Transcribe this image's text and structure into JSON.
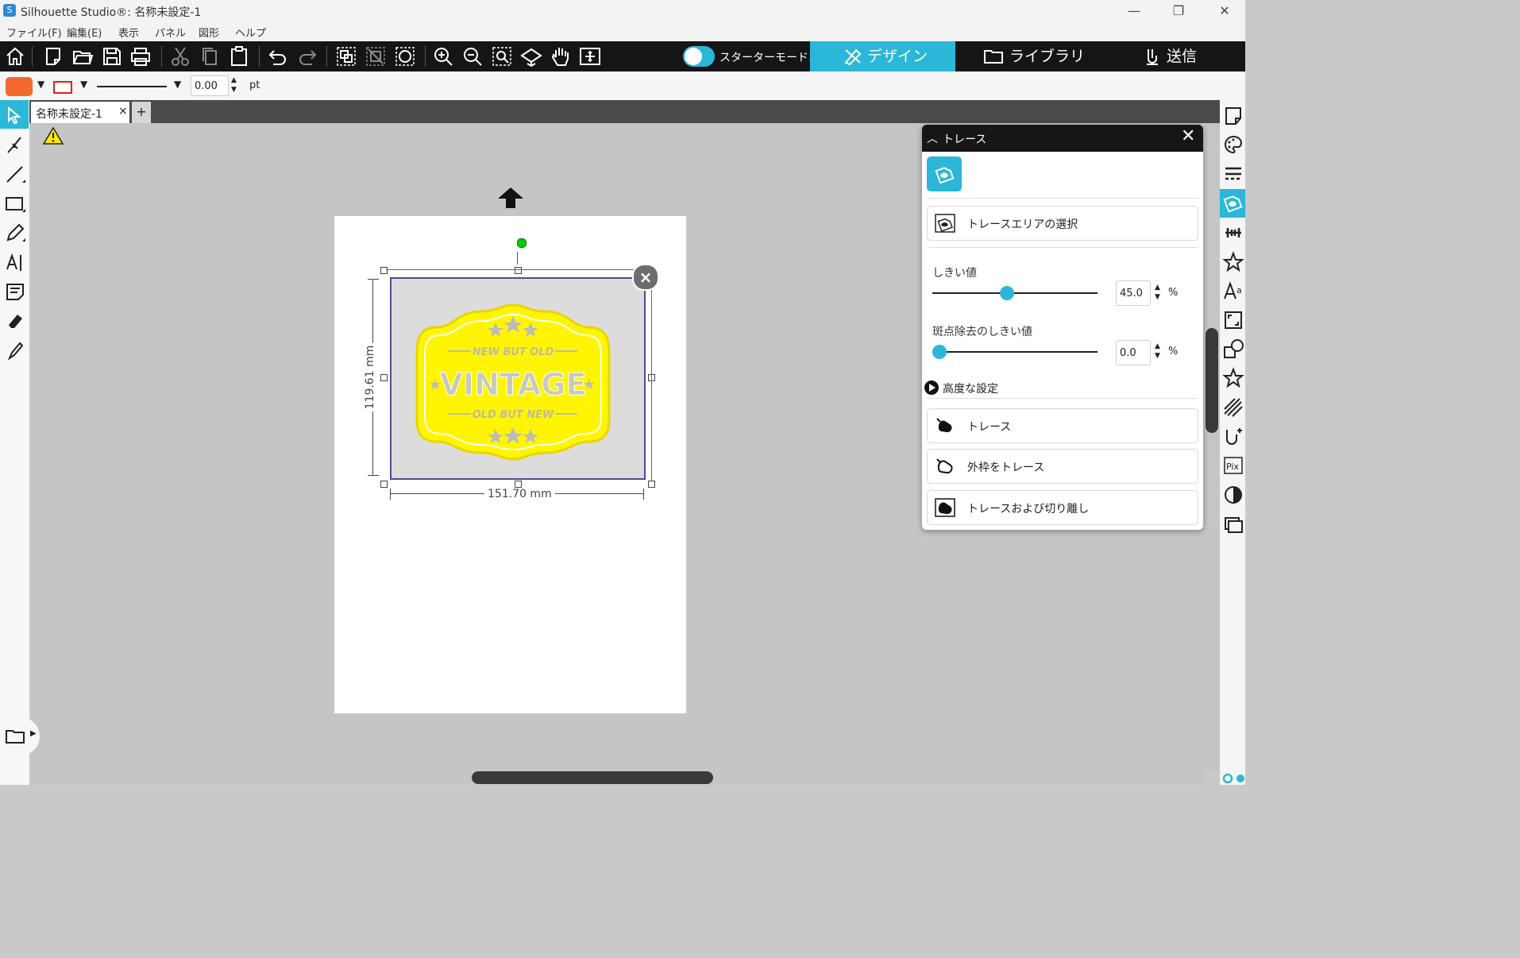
{
  "window": {
    "title": "Silhouette Studio®: 名称未設定-1",
    "app_icon": "S",
    "minimize": "—",
    "maximize": "❐",
    "close": "✕"
  },
  "menu": [
    "ファイル(F)",
    "編集(E)",
    "表示",
    "パネル",
    "図形",
    "ヘルプ"
  ],
  "toolbar": {
    "starter_mode_label": "スターターモードオフ",
    "tabs": {
      "design": "デザイン",
      "library": "ライブラリ",
      "send": "送信"
    },
    "icons": [
      "home-icon",
      "new-icon",
      "open-icon",
      "save-icon",
      "print-icon",
      "cut-icon",
      "copy-icon",
      "paste-icon",
      "undo-icon",
      "redo-icon",
      "group-icon",
      "ungroup-icon",
      "select-all-icon",
      "zoom-in-icon",
      "zoom-out-icon",
      "zoom-fit-icon",
      "pan-icon",
      "hand-icon",
      "fit-page-icon"
    ]
  },
  "properties": {
    "fill_color": "#f26930",
    "line_color": "#e02020",
    "line_width": "0.00",
    "unit": "pt"
  },
  "document_tab": {
    "name": "名称未設定-1",
    "close": "×",
    "add": "+"
  },
  "canvas": {
    "width_dim": "151.70 mm",
    "height_dim": "119.61 mm",
    "badge": {
      "top_text": "NEW BUT OLD",
      "main_text": "VINTAGE",
      "bottom_text": "OLD BUT NEW",
      "color": "#fff500"
    }
  },
  "trace_panel": {
    "title": "トレース",
    "select_area_label": "トレースエリアの選択",
    "threshold_label": "しきい値",
    "threshold_value": "45.0",
    "threshold_fraction": 0.45,
    "despeckle_label": "斑点除去のしきい値",
    "despeckle_value": "0.0",
    "despeckle_fraction": 0.0,
    "percent": "%",
    "advanced_label": "高度な設定",
    "buttons": {
      "trace": "トレース",
      "trace_outer": "外枠をトレース",
      "trace_detach": "トレースおよび切り離し"
    },
    "accent": "#2bb7d8"
  }
}
